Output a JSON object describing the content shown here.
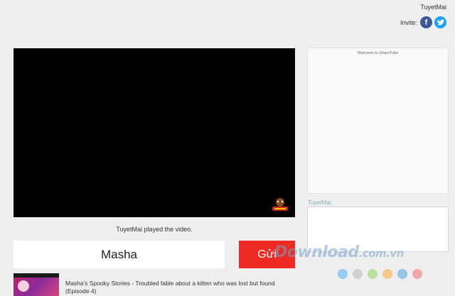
{
  "header": {
    "username": "TuyetMai",
    "invite_label": "Invite:",
    "facebook_glyph": "f",
    "twitter_glyph": "t"
  },
  "player": {
    "status_text": "TuyetMai played the video."
  },
  "search": {
    "value": "Masha",
    "send_label": "Gửi"
  },
  "results": [
    {
      "title": "Masha's Spooky Stories - Troubled fable about a kitten who was lost but found (Episode 4)"
    }
  ],
  "chat": {
    "welcome": "Welcome to ShareTube",
    "current_user": "TuyetMai"
  },
  "watermark": {
    "text_main": "Download",
    "text_suffix": ".com.vn",
    "dot_colors": [
      "#5bb4f0",
      "#bdbdbd",
      "#9bd36b",
      "#f7b24a",
      "#5aa8e0",
      "#f07a7a"
    ]
  }
}
